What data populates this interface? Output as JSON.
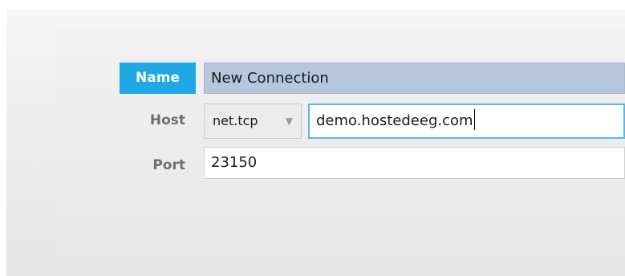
{
  "form": {
    "name_label": "Name",
    "name_value": "New Connection",
    "host_label": "Host",
    "protocol_value": "net.tcp",
    "host_value": "demo.hostedeeg.com",
    "port_label": "Port",
    "port_value": "23150"
  },
  "icons": {
    "dropdown": "chevron-down-icon"
  },
  "colors": {
    "name_label_bg": "#1ea8e6",
    "name_field_bg": "#b6c6dd",
    "focus_border": "#55b6f0"
  }
}
